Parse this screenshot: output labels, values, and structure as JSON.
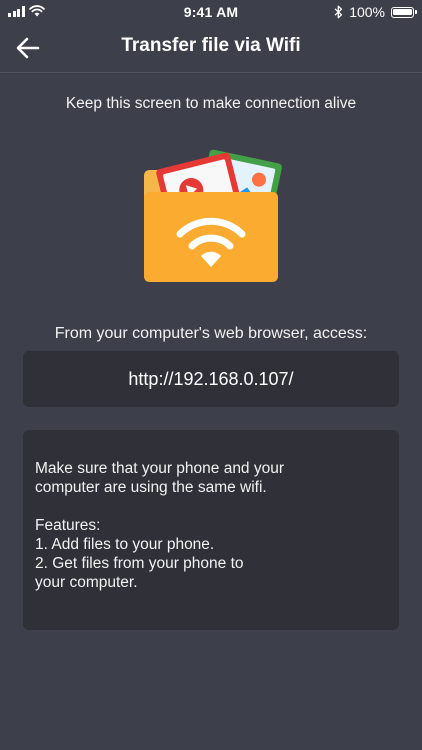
{
  "status_bar": {
    "time": "9:41 AM",
    "battery": "100%",
    "battery_level": 1.0,
    "icons": [
      "signal-icon",
      "wifi-icon",
      "bluetooth-icon",
      "battery-icon"
    ]
  },
  "nav": {
    "back_icon": "back-arrow-icon",
    "title": "Transfer file via Wifi"
  },
  "main": {
    "keep_alive_text": "Keep this screen to make connection alive",
    "illustration_icon": "wifi-folder-icon",
    "access_label": "From your computer's web browser, access:",
    "url": "http://192.168.0.107/",
    "info": {
      "line1": "Make sure that your phone and your",
      "line2": "computer are using the same wifi.",
      "features_heading": "Features:",
      "feature1": "1. Add files to your phone.",
      "feature2_line1": "2. Get files from your phone to",
      "feature2_line2": "your computer."
    }
  },
  "colors": {
    "background": "#3d3f4a",
    "card": "#2f3038",
    "folder": "#fbab2f",
    "folder_tab": "#f5b74a",
    "card_red": "#e53935",
    "card_green": "#43a047",
    "card_blue": "#2196f3",
    "card_orange": "#ff7043"
  }
}
